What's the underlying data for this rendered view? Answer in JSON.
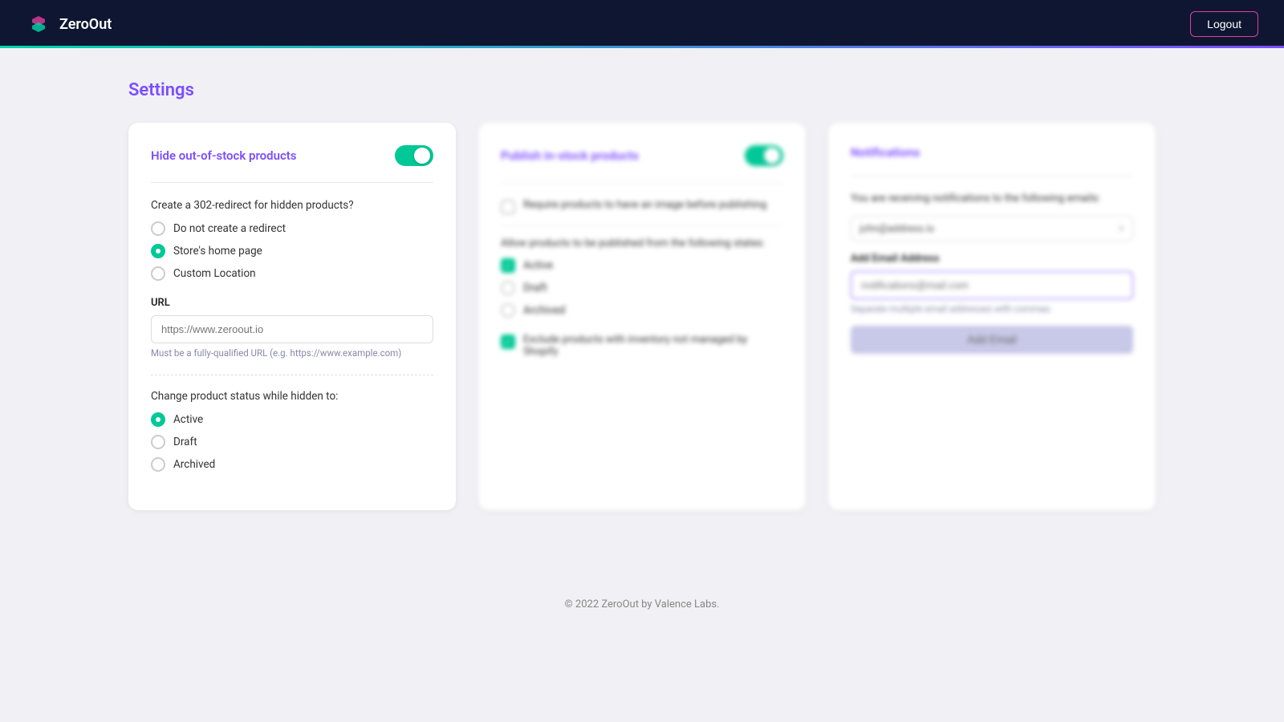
{
  "header": {
    "logo_text": "ZeroOut",
    "logout_label": "Logout"
  },
  "page": {
    "title": "Settings"
  },
  "card1": {
    "title": "Hide out-of-stock products",
    "toggle_on": true,
    "redirect_question": "Create a 302-redirect for hidden products?",
    "redirect_options": [
      {
        "label": "Do not create a redirect",
        "checked": false
      },
      {
        "label": "Store's home page",
        "checked": true
      },
      {
        "label": "Custom Location",
        "checked": false
      }
    ],
    "url_label": "URL",
    "url_placeholder": "https://www.zeroout.io",
    "url_hint": "Must be a fully-qualified URL (e.g. https://www.example.com)",
    "status_label": "Change product status while hidden to:",
    "status_options": [
      {
        "label": "Active",
        "checked": true
      },
      {
        "label": "Draft",
        "checked": false
      },
      {
        "label": "Archived",
        "checked": false
      }
    ]
  },
  "card2": {
    "title": "Publish in-stock products",
    "toggle_on": true,
    "require_image_label": "Require products to have an image before publishing",
    "states_label": "Allow products to be published from the following states:",
    "state_options": [
      {
        "label": "Active",
        "checked": true
      },
      {
        "label": "Draft",
        "checked": false
      },
      {
        "label": "Archived",
        "checked": false
      }
    ],
    "exclude_label": "Exclude products with inventory not managed by Shopify",
    "exclude_checked": true
  },
  "card3": {
    "title": "Notifications",
    "toggle_on": true,
    "receiving_text": "You are receiving notifications to the following emails:",
    "existing_email": "john@address.io",
    "add_email_label": "Add Email Address",
    "add_email_placeholder": "notifications@mail.com",
    "add_email_hint": "Separate multiple email addresses with commas.",
    "add_email_btn_label": "Add Email"
  },
  "footer": {
    "text": "© 2022 ZeroOut by Valence Labs."
  }
}
